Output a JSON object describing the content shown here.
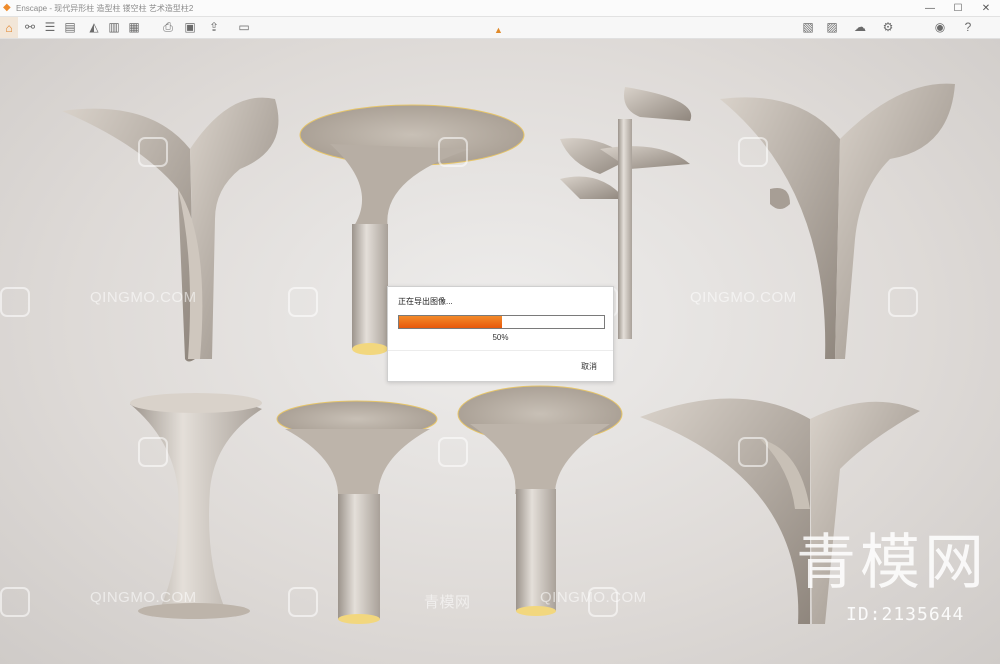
{
  "window": {
    "title": "Enscape - 现代异形柱 造型柱 镂空柱 艺术造型柱2",
    "app_icon": "enscape-logo-icon",
    "controls": [
      "minimize-icon",
      "maximize-icon",
      "close-icon"
    ]
  },
  "toolbar": {
    "buttons": [
      "home-icon",
      "link-icon",
      "settings-list-icon",
      "batch-icon",
      "panorama-icon",
      "video-editor-icon",
      "render-icon",
      "export-icon",
      "batch-render-icon",
      "upload-icon",
      "view-management-icon",
      "material-editor-icon",
      "asset-library-icon",
      "atmosphere-icon",
      "visual-settings-icon",
      "preview-icon",
      "help-icon"
    ],
    "accent": "#e07d1f"
  },
  "watermark": {
    "site": "QINGMO.COM",
    "site_cn": "青模网",
    "brand": "青模网",
    "id": "ID:2135644"
  },
  "dialog": {
    "title": "正在导出图像...",
    "progress_label": "50%",
    "progress_value": 0.5,
    "cancel_label": "取消",
    "fill_color": "#e8590c"
  }
}
